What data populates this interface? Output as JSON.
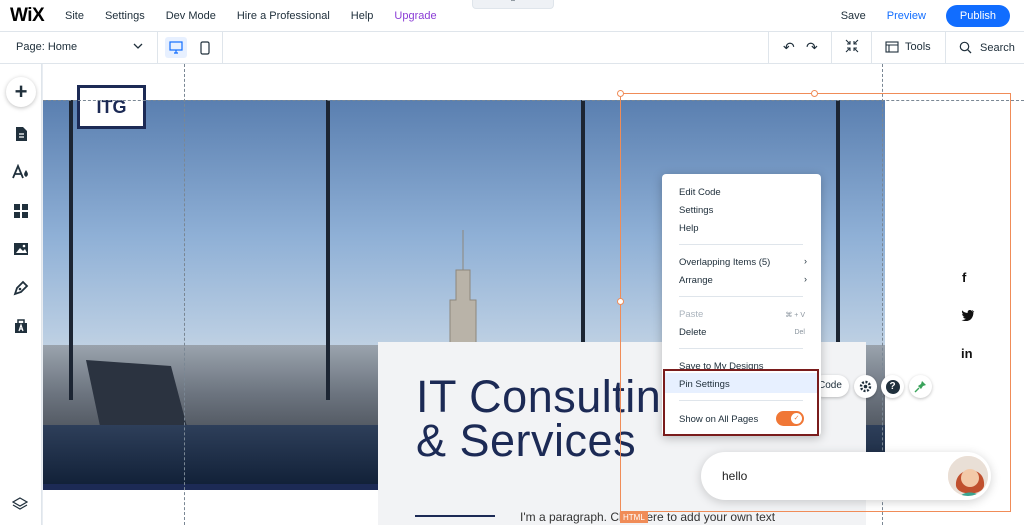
{
  "topbar": {
    "logo": "WiX",
    "menu": [
      "Site",
      "Settings",
      "Dev Mode",
      "Hire a Professional",
      "Help",
      "Upgrade"
    ],
    "collapse_glyph": "⌃",
    "save": "Save",
    "preview": "Preview",
    "publish": "Publish"
  },
  "toolbar2": {
    "page_label": "Page:",
    "page_value": "Home",
    "undo_glyph": "↶",
    "redo_glyph": "↷",
    "tools": "Tools",
    "search": "Search"
  },
  "sidebar": {
    "add_glyph": "+",
    "items": [
      "pages-icon",
      "design-icon",
      "apps-icon",
      "media-icon",
      "blog-icon",
      "business-icon"
    ],
    "bottom": "layers-icon"
  },
  "site": {
    "logo": "ITG",
    "title_line1": "IT Consulting",
    "title_line2": "& Services",
    "paragraph": "I'm a paragraph. Click here to add your own text",
    "social": [
      "f",
      "twitter-icon",
      "in"
    ]
  },
  "selection": {
    "element_tag": "HTML"
  },
  "context_menu": {
    "items": [
      {
        "label": "Edit Code"
      },
      {
        "label": "Settings"
      },
      {
        "label": "Help"
      },
      {
        "label": "Overlapping Items (5)",
        "submenu": true
      },
      {
        "label": "Arrange",
        "submenu": true
      },
      {
        "label": "Paste",
        "shortcut": "⌘ + V",
        "disabled": true
      },
      {
        "label": "Delete",
        "shortcut": "Del"
      },
      {
        "label": "Save to My Designs"
      },
      {
        "label": "Pin Settings",
        "highlighted": true
      },
      {
        "label": "Show on All Pages",
        "toggle": true,
        "toggle_on": true
      }
    ],
    "submenu_glyph": "›",
    "toggle_check": "✓"
  },
  "floating": {
    "code_label": "Code",
    "help_glyph": "?"
  },
  "chat": {
    "message": "hello"
  },
  "colors": {
    "accent_blue": "#116dff",
    "upgrade_purple": "#8b3dd6",
    "selection_orange": "#f08c58",
    "toggle_orange": "#f07736",
    "site_navy": "#1c2a55",
    "annotation_red": "#7a1c1c"
  }
}
